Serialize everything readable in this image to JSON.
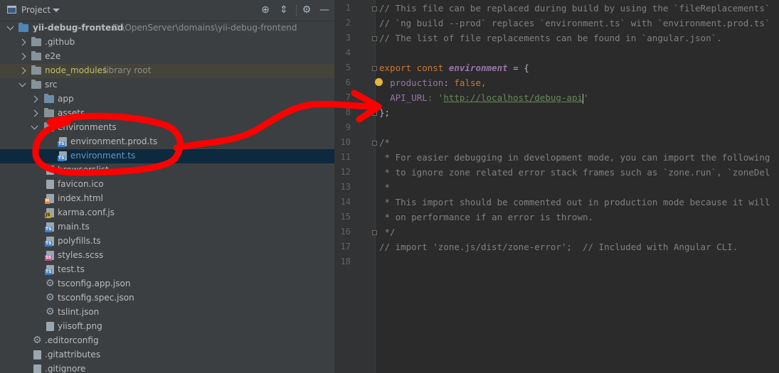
{
  "toolbar": {
    "title": "Project"
  },
  "tree": [
    {
      "label": "yii-debug-frontend",
      "path": "D:\\OpenServer\\domains\\yii-debug-frontend",
      "type": "root"
    },
    {
      "label": ".github",
      "type": "folder"
    },
    {
      "label": "e2e",
      "type": "folder"
    },
    {
      "label": "node_modules",
      "suffix": "library root",
      "type": "folder-lib"
    },
    {
      "label": "src",
      "type": "folder-open"
    },
    {
      "label": "app",
      "type": "folder"
    },
    {
      "label": "assets",
      "type": "folder"
    },
    {
      "label": "environments",
      "type": "folder-open"
    },
    {
      "label": "environment.prod.ts",
      "type": "ts"
    },
    {
      "label": "environment.ts",
      "type": "ts-selected"
    },
    {
      "label": "browserslist",
      "type": "file"
    },
    {
      "label": "favicon.ico",
      "type": "file"
    },
    {
      "label": "index.html",
      "type": "html"
    },
    {
      "label": "karma.conf.js",
      "type": "js"
    },
    {
      "label": "main.ts",
      "type": "ts"
    },
    {
      "label": "polyfills.ts",
      "type": "ts"
    },
    {
      "label": "styles.scss",
      "type": "scss"
    },
    {
      "label": "test.ts",
      "type": "ts"
    },
    {
      "label": "tsconfig.app.json",
      "type": "json"
    },
    {
      "label": "tsconfig.spec.json",
      "type": "json"
    },
    {
      "label": "tslint.json",
      "type": "json"
    },
    {
      "label": "yiisoft.png",
      "type": "image"
    },
    {
      "label": ".editorconfig",
      "type": "config"
    },
    {
      "label": ".gitattributes",
      "type": "file"
    },
    {
      "label": ".gitignore",
      "type": "file"
    }
  ],
  "editor": {
    "line_numbers": [
      "1",
      "2",
      "3",
      "4",
      "5",
      "6",
      "7",
      "8",
      "9",
      "10",
      "11",
      "12",
      "13",
      "14",
      "15",
      "16",
      "17",
      "18"
    ],
    "lines": {
      "l1": "// This file can be replaced during build by using the `fileReplacements`",
      "l2": "// `ng build --prod` replaces `environment.ts` with `environment.prod.ts`",
      "l3": "// The list of file replacements can be found in `angular.json`.",
      "l5_kw": "export const ",
      "l5_var": "environment",
      "l5_rest": " = {",
      "l6_prop": "production",
      "l6_rest": ": ",
      "l6_val": "false",
      "l6_end": ",",
      "l7_prop": "API_URL",
      "l7_rest": ": '",
      "l7_url": "http://localhost/debug-api",
      "l7_end": "'",
      "l8": "};",
      "l10": "/*",
      "l11": " * For easier debugging in development mode, you can import the following",
      "l12": " * to ignore zone related error stack frames such as `zone.run`, `zoneDel",
      "l13": " *",
      "l14": " * This import should be commented out in production mode because it will",
      "l15": " * on performance if an error is thrown.",
      "l16": " */",
      "l17": "// import 'zone.js/dist/zone-error';  // Included with Angular CLI."
    }
  },
  "colors": {
    "annotation": "#ff0000",
    "accent_selected": "#0d293e"
  }
}
